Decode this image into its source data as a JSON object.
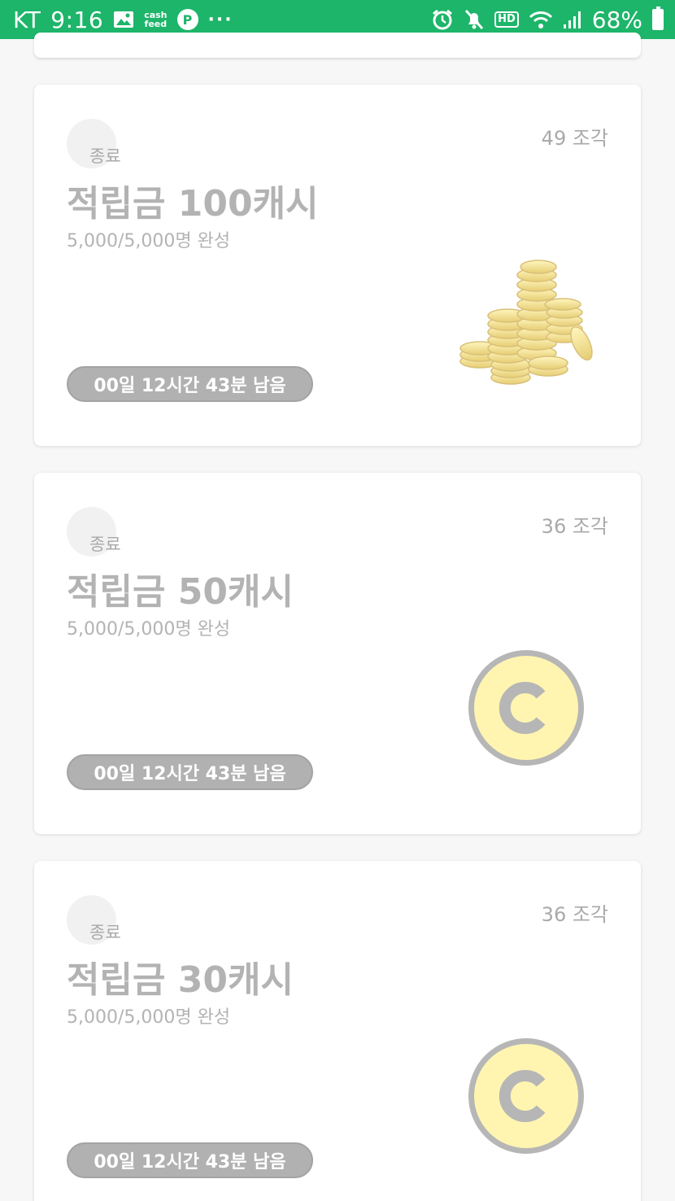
{
  "status_bar": {
    "carrier": "KT",
    "time": "9:16",
    "cash_app_line1": "cash",
    "cash_app_line2": "feed",
    "p_badge": "P",
    "more": "···",
    "hd_label": "HD",
    "battery": "68%",
    "icons": [
      "image-icon",
      "cashfeed-icon",
      "p-badge-icon",
      "more-icon",
      "alarm-icon",
      "mute-icon",
      "hd-icon",
      "wifi-icon",
      "signal-icon",
      "battery-icon"
    ]
  },
  "cards": [
    {
      "status": "종료",
      "pieces": "49 조각",
      "title": "적립금 100캐시",
      "progress": "5,000/5,000명 완성",
      "timer": "00일 12시간 43분 남음",
      "image": "coin-stack"
    },
    {
      "status": "종료",
      "pieces": "36 조각",
      "title": "적립금 50캐시",
      "progress": "5,000/5,000명 완성",
      "timer": "00일 12시간 43분 남음",
      "image": "cash-coin"
    },
    {
      "status": "종료",
      "pieces": "36 조각",
      "title": "적립금 30캐시",
      "progress": "5,000/5,000명 완성",
      "timer": "00일 12시간 43분 남음",
      "image": "cash-coin"
    }
  ],
  "colors": {
    "status_bar": "#1db56a",
    "timer_pill": "#b1b1b1",
    "coin_fill": "#fff5b0",
    "muted_text": "#b3b3b3"
  }
}
